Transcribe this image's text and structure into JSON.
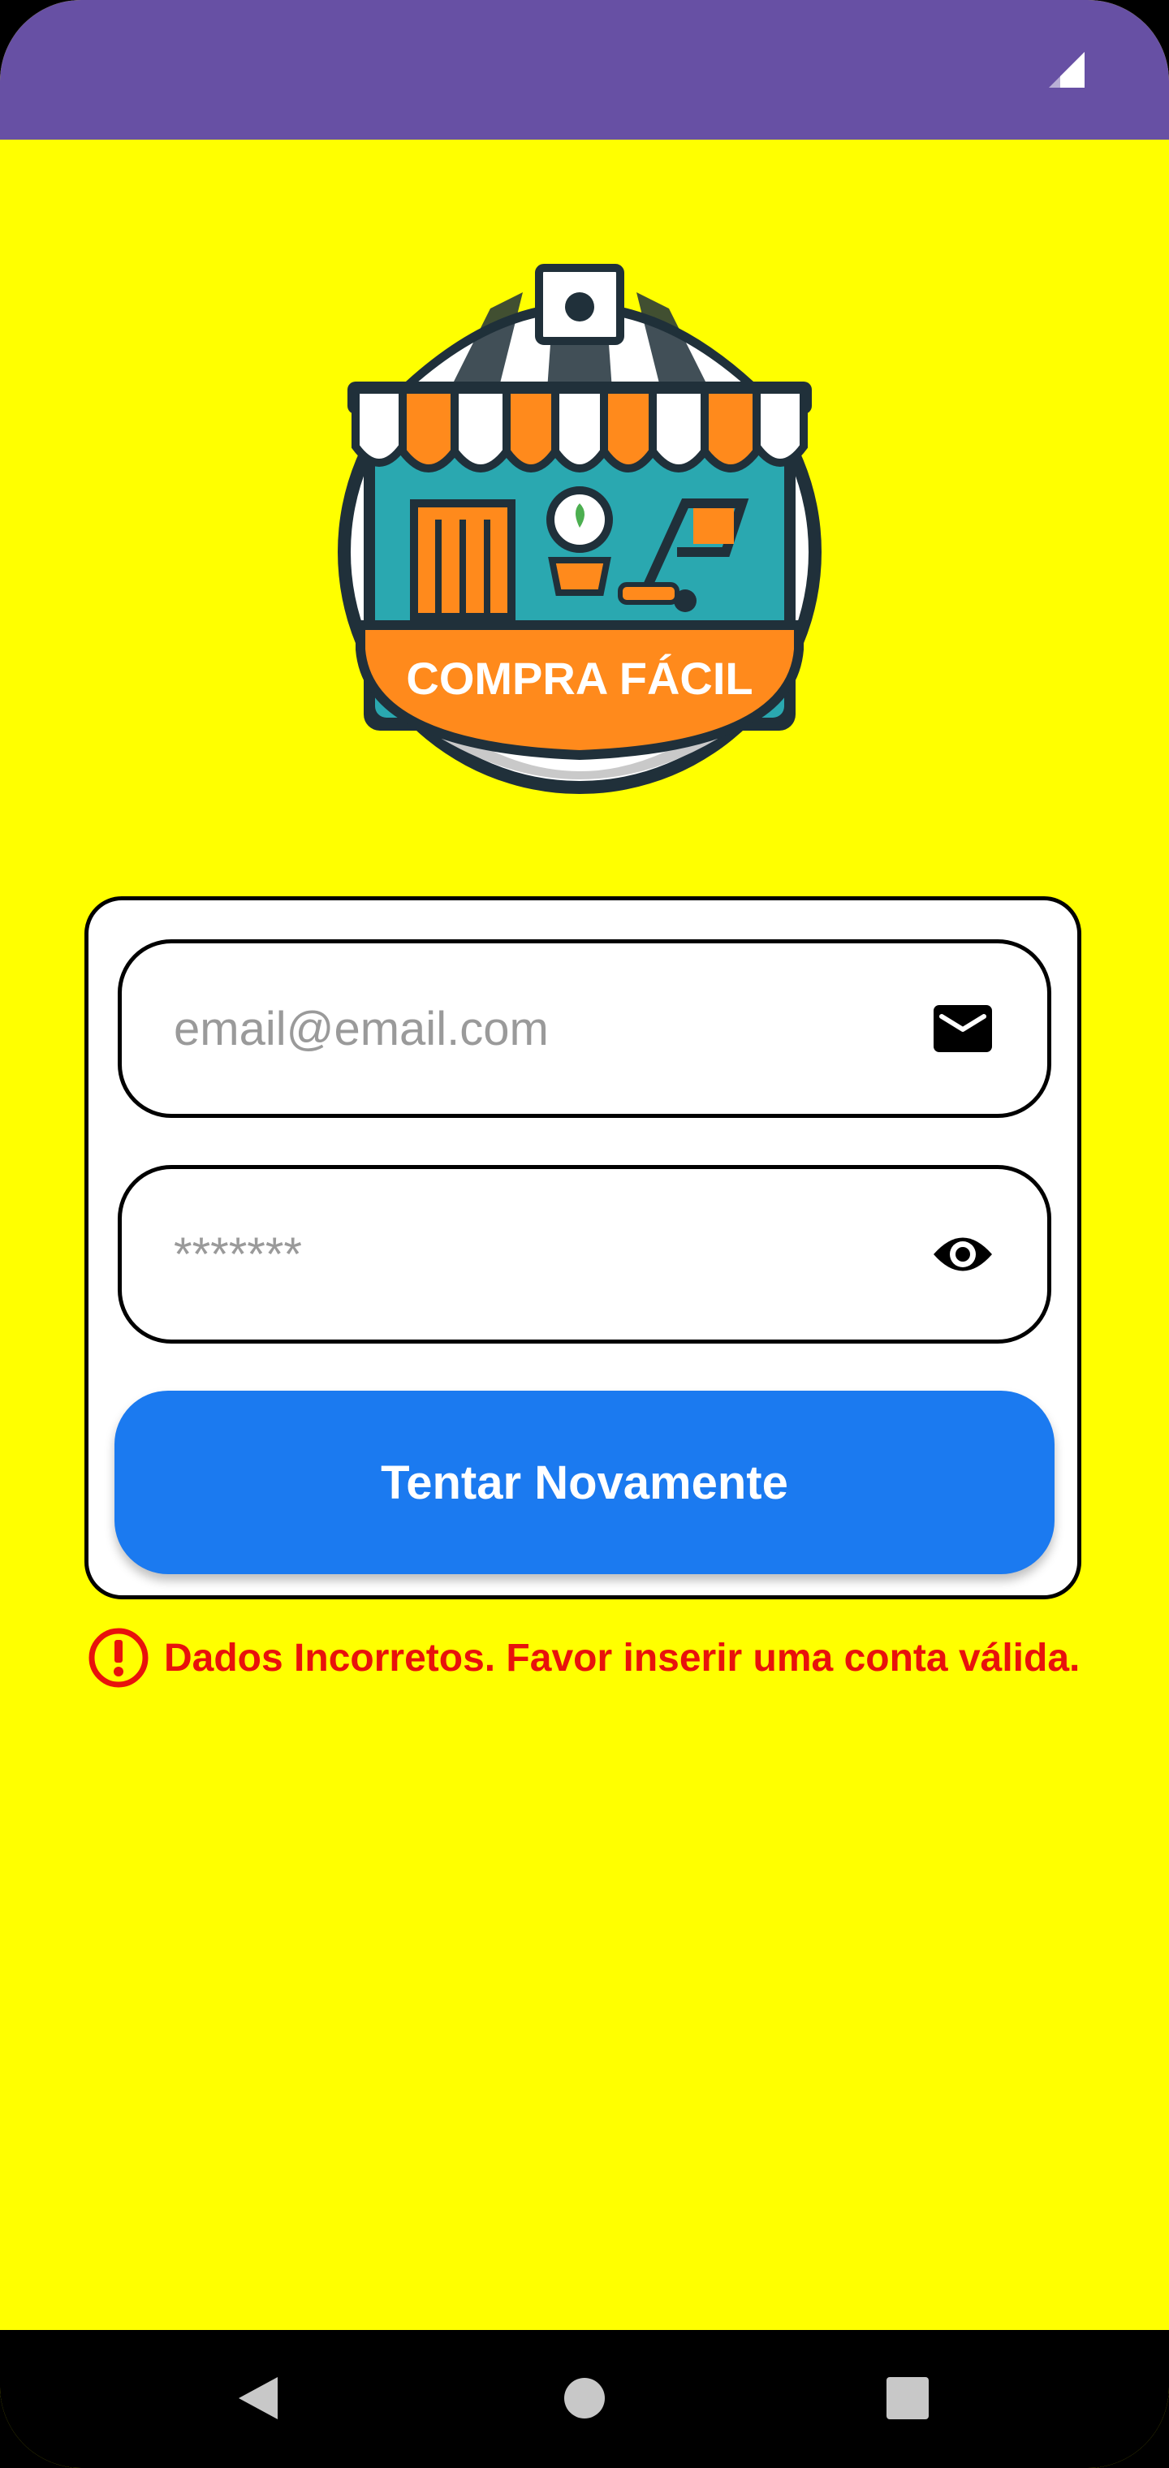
{
  "status_bar": {
    "color": "#6750A4",
    "icons": [
      "signal-icon"
    ]
  },
  "logo": {
    "text": "COMPRA FÁCIL",
    "icon": "shop-logo"
  },
  "login_form": {
    "email_placeholder": "email@email.com",
    "email_icon": "mail-icon",
    "password_placeholder": "*******",
    "password_icon": "eye-icon",
    "submit_label": "Tentar Novamente",
    "submit_color": "#1B7AF0"
  },
  "error": {
    "icon": "error-icon",
    "message": "Dados Incorretos. Favor inserir uma conta válida.",
    "color": "#E8120C"
  },
  "background_color": "#FFFF00",
  "nav_bar": {
    "items": [
      "back-icon",
      "home-icon",
      "recents-icon"
    ]
  }
}
